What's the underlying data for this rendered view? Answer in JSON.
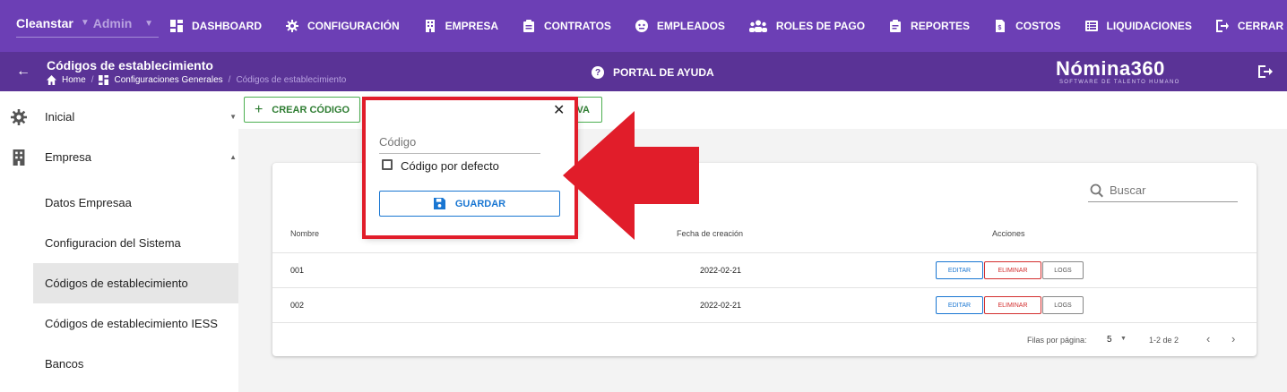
{
  "topnav": {
    "company": "Cleanstar",
    "role": "Admin",
    "items": [
      {
        "label": "DASHBOARD",
        "icon": "dashboard-icon"
      },
      {
        "label": "CONFIGURACIÓN",
        "icon": "gear-icon"
      },
      {
        "label": "EMPRESA",
        "icon": "building-icon"
      },
      {
        "label": "CONTRATOS",
        "icon": "clipboard-icon"
      },
      {
        "label": "EMPLEADOS",
        "icon": "face-icon"
      },
      {
        "label": "ROLES DE PAGO",
        "icon": "people-icon"
      },
      {
        "label": "REPORTES",
        "icon": "report-icon"
      },
      {
        "label": "COSTOS",
        "icon": "cost-file-icon"
      },
      {
        "label": "LIQUIDACIONES",
        "icon": "list-icon"
      },
      {
        "label": "CERRAR SESIÓN",
        "icon": "logout-icon"
      }
    ]
  },
  "subbar": {
    "title": "Códigos de establecimiento",
    "breadcrumb": [
      "Home",
      "Configuraciones Generales",
      "Códigos de establecimiento"
    ],
    "help": "PORTAL DE AYUDA",
    "brand": "Nómina360",
    "brand_sub": "SOFTWARE DE TALENTO HUMANO"
  },
  "sidebar": {
    "items": [
      {
        "label": "Inicial",
        "icon": "gear-icon"
      },
      {
        "label": "Empresa",
        "icon": "building-icon"
      },
      {
        "label": "Datos Empresaa"
      },
      {
        "label": "Configuracion del Sistema"
      },
      {
        "label": "Códigos de establecimiento"
      },
      {
        "label": "Códigos de establecimiento IESS"
      },
      {
        "label": "Bancos"
      }
    ]
  },
  "toolbar": {
    "create_label": "CREAR CÓDIGO",
    "second_label_visible": "VA"
  },
  "table": {
    "search_placeholder": "Buscar",
    "headers": [
      "Nombre",
      "Fecha de creación",
      "Acciones"
    ],
    "rows": [
      {
        "name": "001",
        "date": "2022-02-21"
      },
      {
        "name": "002",
        "date": "2022-02-21"
      }
    ],
    "actions": {
      "edit": "EDITAR",
      "delete": "ELIMINAR",
      "logs": "LOGS"
    },
    "footer": {
      "rows_label": "Filas por página:",
      "rows_value": "5",
      "range": "1-2 de 2"
    }
  },
  "popup": {
    "close": "✕",
    "input_placeholder": "Código",
    "checkbox_label": "Código por defecto",
    "save_label": "GUARDAR"
  },
  "colors": {
    "nav": "#6c3fb5",
    "subbar": "#5a3396",
    "create_green": "#4caf50",
    "primary_blue": "#1976d2",
    "delete_red": "#d32f2f",
    "highlight_red": "#e11d2a"
  }
}
